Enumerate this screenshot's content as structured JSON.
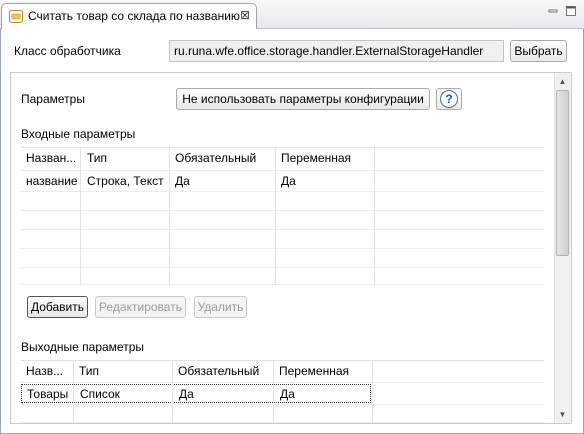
{
  "tab": {
    "title": "Считать товар со склада по названию"
  },
  "handler": {
    "label": "Класс обработчика",
    "value": "ru.runa.wfe.office.storage.handler.ExternalStorageHandler",
    "choose_label": "Выбрать"
  },
  "params": {
    "label": "Параметры",
    "config_button": "Не использовать параметры конфигурации",
    "help_symbol": "?"
  },
  "input_params": {
    "title": "Входные параметры",
    "columns": [
      "Назван...",
      "Тип",
      "Обязательный",
      "Переменная"
    ],
    "rows": [
      [
        "название",
        "Строка, Текст",
        "Да",
        "Да"
      ]
    ],
    "add_label": "Добавить",
    "edit_label": "Редактировать",
    "delete_label": "Удалить"
  },
  "output_params": {
    "title": "Выходные параметры",
    "columns": [
      "Назв...",
      "Тип",
      "Обязательный",
      "Переменная"
    ],
    "rows": [
      [
        "Товары",
        "Список",
        "Да",
        "Да"
      ]
    ]
  }
}
